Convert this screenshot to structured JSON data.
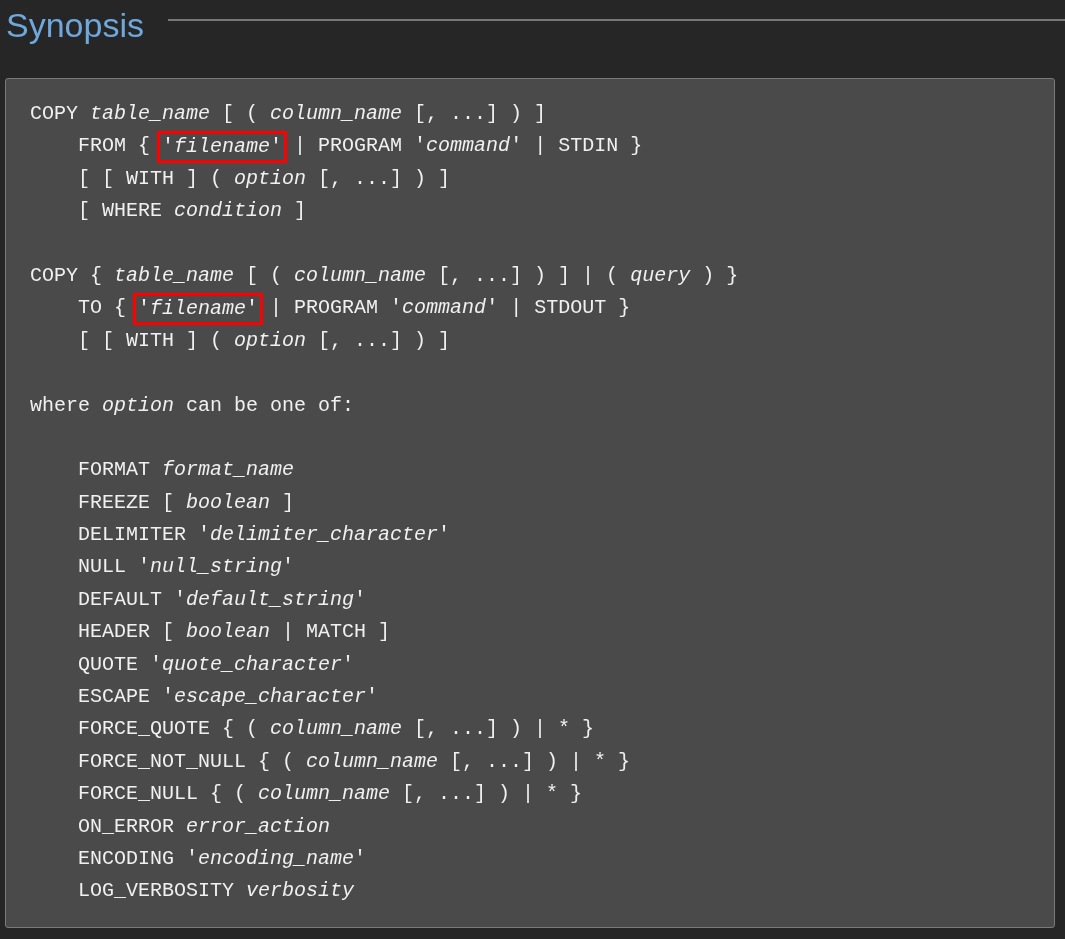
{
  "heading": "Synopsis",
  "blocks": [
    [
      {
        "text": "COPY *table_name* [ ( *column_name* [, ...] ) ]"
      },
      {
        "text": "    FROM { ",
        "boxed": "'*filename*'",
        "after": " | PROGRAM '*command*' | STDIN }"
      },
      {
        "text": "    [ [ WITH ] ( *option* [, ...] ) ]"
      },
      {
        "text": "    [ WHERE *condition* ]"
      }
    ],
    [
      {
        "text": "COPY { *table_name* [ ( *column_name* [, ...] ) ] | ( *query* ) }"
      },
      {
        "text": "    TO { ",
        "boxed": "'*filename*'",
        "after": " | PROGRAM '*command*' | STDOUT }"
      },
      {
        "text": "    [ [ WITH ] ( *option* [, ...] ) ]"
      }
    ],
    [
      {
        "text": "where *option* can be one of:"
      }
    ],
    [
      {
        "text": "    FORMAT *format_name*"
      },
      {
        "text": "    FREEZE [ *boolean* ]"
      },
      {
        "text": "    DELIMITER '*delimiter_character*'"
      },
      {
        "text": "    NULL '*null_string*'"
      },
      {
        "text": "    DEFAULT '*default_string*'"
      },
      {
        "text": "    HEADER [ *boolean* | MATCH ]"
      },
      {
        "text": "    QUOTE '*quote_character*'"
      },
      {
        "text": "    ESCAPE '*escape_character*'"
      },
      {
        "text": "    FORCE_QUOTE { ( *column_name* [, ...] ) | * }"
      },
      {
        "text": "    FORCE_NOT_NULL { ( *column_name* [, ...] ) | * }"
      },
      {
        "text": "    FORCE_NULL { ( *column_name* [, ...] ) | * }"
      },
      {
        "text": "    ON_ERROR *error_action*"
      },
      {
        "text": "    ENCODING '*encoding_name*'"
      },
      {
        "text": "    LOG_VERBOSITY *verbosity*"
      }
    ]
  ]
}
